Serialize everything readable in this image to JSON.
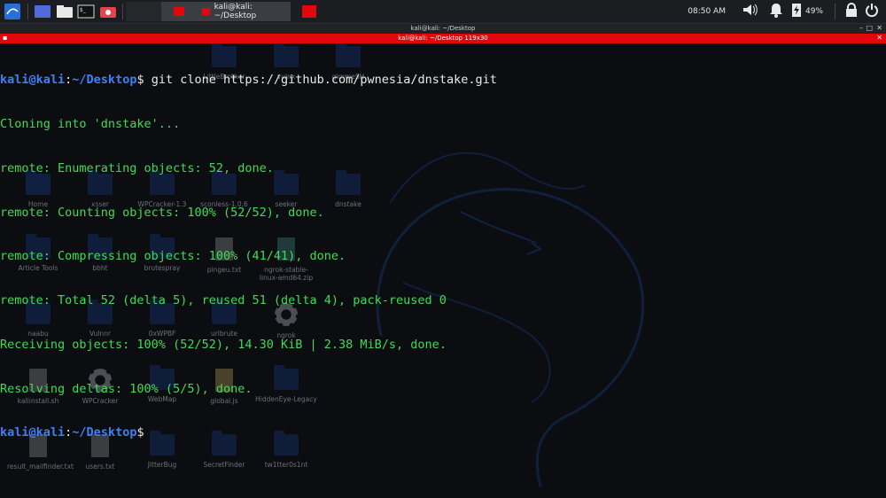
{
  "panel": {
    "window_title": "kali@kali: ~/Desktop",
    "clock": "08:50 AM",
    "battery": "49%"
  },
  "terminal": {
    "title": "kali@kali: ~/Desktop",
    "tab_title": "kali@kali: ~/Desktop 119x30",
    "prompt_user": "kali@kali",
    "prompt_colon": ":",
    "prompt_path": "~/Desktop",
    "prompt_symbol": "$",
    "command": " git clone https://github.com/pwnesia/dnstake.git",
    "output": [
      "Cloning into 'dnstake'...",
      "remote: Enumerating objects: 52, done.",
      "remote: Counting objects: 100% (52/52), done.",
      "remote: Compressing objects: 100% (41/41), done.",
      "remote: Total 52 (delta 5), reused 51 (delta 4), pack-reused 0",
      "Receiving objects: 100% (52/52), 14.30 KiB | 2.38 MiB/s, done.",
      "Resolving deltas: 100% (5/5), done."
    ]
  },
  "desktop": {
    "icons": [
      {
        "label": "LittleBrother",
        "kind": "folder"
      },
      {
        "label": "vulnx",
        "kind": "folder"
      },
      {
        "label": "gimmeSH",
        "kind": "folder"
      },
      {
        "label": "Home",
        "kind": "home"
      },
      {
        "label": "xsser",
        "kind": "folder"
      },
      {
        "label": "WPCracker-1.3",
        "kind": "folder"
      },
      {
        "label": "sconless-1.0.6",
        "kind": "folder"
      },
      {
        "label": "seeker",
        "kind": "folder"
      },
      {
        "label": "dnstake",
        "kind": "folder"
      },
      {
        "label": "Article Tools",
        "kind": "folder"
      },
      {
        "label": "bbht",
        "kind": "folder"
      },
      {
        "label": "brutespray",
        "kind": "folder"
      },
      {
        "label": "pingeu.txt",
        "kind": "file"
      },
      {
        "label": "ngrok-stable-linux-amd64.zip",
        "kind": "zip"
      },
      {
        "label": "naabu",
        "kind": "folder"
      },
      {
        "label": "Vulnnr",
        "kind": "folder"
      },
      {
        "label": "0xWPBF",
        "kind": "folder"
      },
      {
        "label": "urlbrute",
        "kind": "folder"
      },
      {
        "label": "ngrok",
        "kind": "gear"
      },
      {
        "label": "kaliinstall.sh",
        "kind": "file"
      },
      {
        "label": "WPCracker",
        "kind": "gear"
      },
      {
        "label": "WebMap",
        "kind": "folder"
      },
      {
        "label": "global.js",
        "kind": "filey"
      },
      {
        "label": "HiddenEye-Legacy",
        "kind": "folder"
      },
      {
        "label": "result_mailfinder.txt",
        "kind": "file"
      },
      {
        "label": "users.txt",
        "kind": "file"
      },
      {
        "label": "JitterBug",
        "kind": "folder"
      },
      {
        "label": "SecretFinder",
        "kind": "folder"
      },
      {
        "label": "tw1tter0s1nt",
        "kind": "folder"
      }
    ]
  },
  "colors": {
    "terminal_green": "#3fdc55",
    "prompt_blue": "#3b82f6",
    "tab_red": "#e3070c",
    "background": "#0b0d10"
  }
}
